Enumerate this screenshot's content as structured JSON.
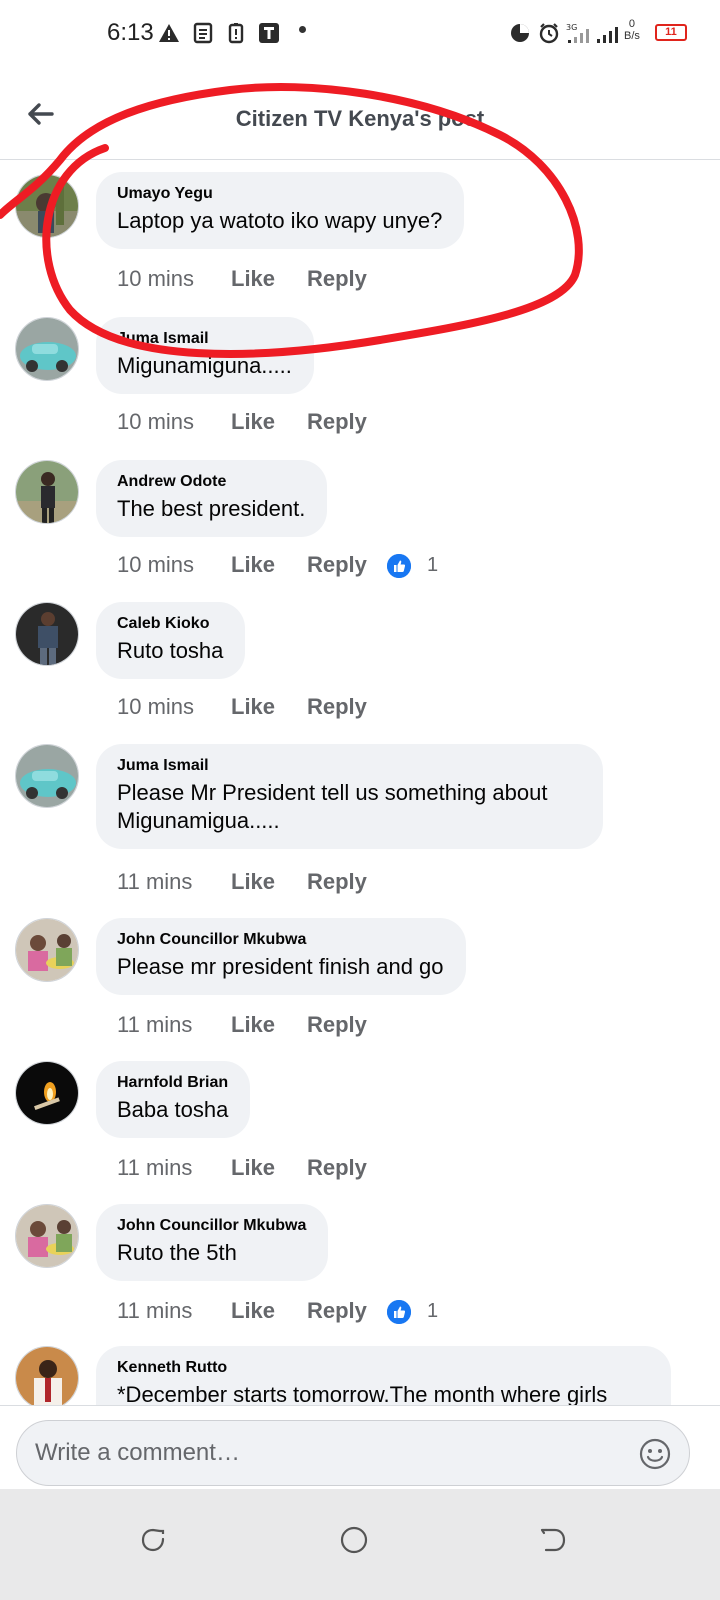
{
  "status_bar": {
    "time": "6:13",
    "net_speed_value": "0",
    "net_speed_unit": "B/s",
    "battery": "11",
    "signal": "3G"
  },
  "header": {
    "title": "Citizen TV Kenya's post",
    "back_icon": "arrow-left-icon"
  },
  "colors": {
    "bubble": "#f0f2f5",
    "meta_text": "#65676b",
    "like_blue": "#1877f2",
    "annotation_red": "#ee1c24"
  },
  "comments": [
    {
      "author": "Umayo Yegu",
      "text": "Laptop ya watoto iko wapy unye?",
      "time": "10 mins",
      "like": "Like",
      "reply": "Reply"
    },
    {
      "author": "Juma Ismail",
      "text": "Migunamiguna.....",
      "time": "10 mins",
      "like": "Like",
      "reply": "Reply"
    },
    {
      "author": "Andrew Odote",
      "text": "The best president.",
      "time": "10 mins",
      "like": "Like",
      "reply": "Reply",
      "reactions": "1"
    },
    {
      "author": "Caleb Kioko",
      "text": "Ruto tosha",
      "time": "10 mins",
      "like": "Like",
      "reply": "Reply"
    },
    {
      "author": "Juma Ismail",
      "text": "Please Mr President tell us something about Migunamigua.....",
      "time": "11 mins",
      "like": "Like",
      "reply": "Reply"
    },
    {
      "author": "John Councillor Mkubwa",
      "text": "Please mr president finish and go",
      "time": "11 mins",
      "like": "Like",
      "reply": "Reply"
    },
    {
      "author": "Harnfold Brian",
      "text": "Baba tosha",
      "time": "11 mins",
      "like": "Like",
      "reply": "Reply"
    },
    {
      "author": "John Councillor Mkubwa",
      "text": "Ruto the 5th",
      "time": "11 mins",
      "like": "Like",
      "reply": "Reply",
      "reactions": "1"
    },
    {
      "author": "Kenneth Rutto",
      "text": "*December starts tomorrow.The month where girls"
    }
  ],
  "composer": {
    "placeholder": "Write a comment…",
    "emoji_icon": "smiley-icon"
  },
  "nav_bar": {
    "recents_icon": "recents-icon",
    "home_icon": "home-circle-icon",
    "back_icon": "back-icon"
  }
}
